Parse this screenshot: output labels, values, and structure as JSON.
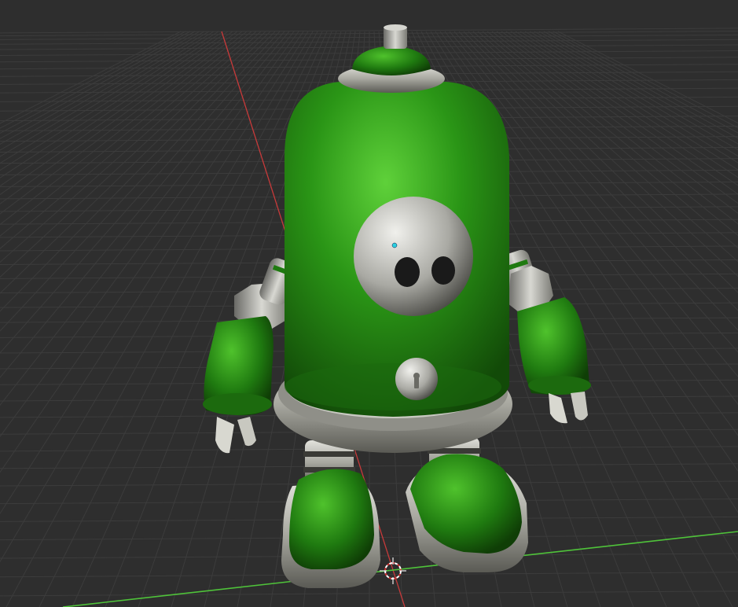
{
  "viewport": {
    "background": "#2e2e2e",
    "grid_color": "#3c3c3c",
    "x_axis_color": "#c83a3a",
    "y_axis_color": "#4fc33a"
  },
  "model": {
    "body_color": "#1f7a10",
    "body_highlight": "#5fd13a",
    "metal_color": "#b9b9b9",
    "metal_dark": "#6c6c6c"
  },
  "icons": [
    "3d-cursor-icon",
    "origin-point-icon"
  ]
}
